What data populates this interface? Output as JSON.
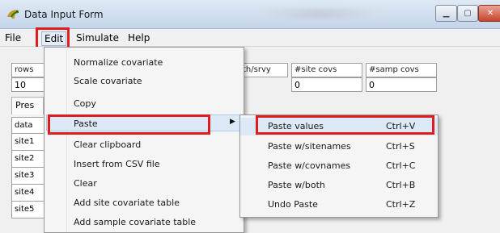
{
  "window": {
    "title": "Data Input Form"
  },
  "menubar": {
    "file": "File",
    "edit": "Edit",
    "simulate": "Simulate",
    "help": "Help"
  },
  "form": {
    "rows_label": "rows",
    "rows_value": "10",
    "col_frag": "th/srvy",
    "site_covs_label": "#site covs",
    "site_covs_value": "0",
    "samp_covs_label": "#samp covs",
    "samp_covs_value": "0",
    "presence_tab": "Pres",
    "grid_rows": [
      "data",
      "site1",
      "site2",
      "site3",
      "site4",
      "site5"
    ]
  },
  "edit_menu": {
    "items": [
      "Normalize covariate",
      "Scale covariate",
      "Copy",
      "Paste",
      "Clear clipboard",
      "Insert from CSV file",
      "Clear",
      "Add site covariate table",
      "Add sample covariate table"
    ]
  },
  "paste_submenu": {
    "items": [
      {
        "label": "Paste values",
        "shortcut": "Ctrl+V"
      },
      {
        "label": "Paste w/sitenames",
        "shortcut": "Ctrl+S"
      },
      {
        "label": "Paste w/covnames",
        "shortcut": "Ctrl+C"
      },
      {
        "label": "Paste w/both",
        "shortcut": "Ctrl+B"
      },
      {
        "label": "Undo Paste",
        "shortcut": "Ctrl+Z"
      }
    ]
  },
  "colors": {
    "highlight": "#e01c1c",
    "menu_hover": "#dde9f7"
  },
  "icons": {
    "app": "bird-icon",
    "submenu": "submenu-arrow-icon",
    "minimize": "minimize-icon",
    "maximize": "maximize-icon",
    "close": "close-icon"
  }
}
